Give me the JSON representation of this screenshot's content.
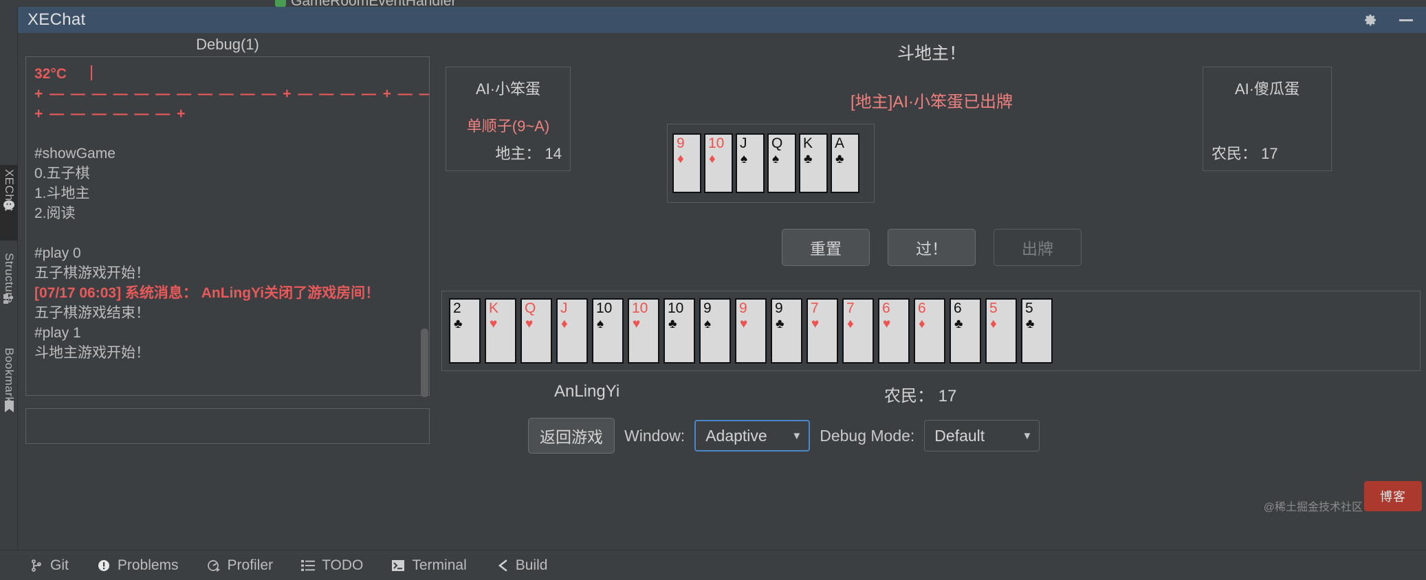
{
  "ide": {
    "ghost_tab": "GameRoomEventHandler",
    "left_tabs": [
      {
        "label": "XEChat",
        "icon": "chat-bubble-icon",
        "active": true
      },
      {
        "label": "Structure",
        "icon": "structure-icon",
        "active": false
      },
      {
        "label": "Bookmarks",
        "icon": "bookmark-icon",
        "active": false
      }
    ],
    "status_bar": [
      {
        "label": "Git",
        "icon": "git-branch-icon"
      },
      {
        "label": "Problems",
        "icon": "problems-icon"
      },
      {
        "label": "Profiler",
        "icon": "profiler-icon"
      },
      {
        "label": "TODO",
        "icon": "todo-list-icon"
      },
      {
        "label": "Terminal",
        "icon": "terminal-icon"
      },
      {
        "label": "Build",
        "icon": "build-hammer-icon"
      }
    ]
  },
  "window": {
    "title": "XEChat",
    "settings_icon": "gear-icon",
    "minimize_icon": "minimize-icon"
  },
  "debug": {
    "header": "Debug(1)",
    "lines": [
      {
        "text": "32°C",
        "style": "red",
        "cursor": true
      },
      {
        "text": "+ — — — — — — — — — — — + — — — — + — — — — —",
        "style": "redplain"
      },
      {
        "text": "+ — — — — — — +",
        "style": "redplain"
      },
      {
        "text": "",
        "style": "blank"
      },
      {
        "text": "#showGame",
        "style": "normal"
      },
      {
        "text": "0.五子棋",
        "style": "normal"
      },
      {
        "text": "1.斗地主",
        "style": "normal"
      },
      {
        "text": "2.阅读",
        "style": "normal"
      },
      {
        "text": "",
        "style": "blank"
      },
      {
        "text": "#play 0",
        "style": "normal"
      },
      {
        "text": "五子棋游戏开始！",
        "style": "normal"
      },
      {
        "text": "[07/17 06:03] 系统消息： AnLingYi关闭了游戏房间！",
        "style": "red"
      },
      {
        "text": "五子棋游戏结束！",
        "style": "normal"
      },
      {
        "text": "#play 1",
        "style": "normal"
      },
      {
        "text": "斗地主游戏开始！",
        "style": "normal"
      }
    ],
    "input_value": ""
  },
  "game": {
    "title": "斗地主！",
    "status_message": "[地主]AI·小笨蛋已出牌",
    "ai_left": {
      "name": "AI·小笨蛋",
      "move": "单顺子(9~A)",
      "role_count": "地主： 14"
    },
    "ai_right": {
      "name": "AI·傻瓜蛋",
      "move": "",
      "role_count": "农民： 17"
    },
    "played_cards": [
      {
        "rank": "9",
        "suit": "♦",
        "color": "red"
      },
      {
        "rank": "10",
        "suit": "♦",
        "color": "red"
      },
      {
        "rank": "J",
        "suit": "♠",
        "color": "black"
      },
      {
        "rank": "Q",
        "suit": "♠",
        "color": "black"
      },
      {
        "rank": "K",
        "suit": "♣",
        "color": "black"
      },
      {
        "rank": "A",
        "suit": "♣",
        "color": "black"
      }
    ],
    "actions": [
      {
        "label": "重置",
        "enabled": true
      },
      {
        "label": "过！",
        "enabled": true
      },
      {
        "label": "出牌",
        "enabled": false
      }
    ],
    "hand_cards": [
      {
        "rank": "2",
        "suit": "♣",
        "color": "black"
      },
      {
        "rank": "K",
        "suit": "♥",
        "color": "red"
      },
      {
        "rank": "Q",
        "suit": "♥",
        "color": "red"
      },
      {
        "rank": "J",
        "suit": "♦",
        "color": "red"
      },
      {
        "rank": "10",
        "suit": "♠",
        "color": "black"
      },
      {
        "rank": "10",
        "suit": "♥",
        "color": "red"
      },
      {
        "rank": "10",
        "suit": "♣",
        "color": "black"
      },
      {
        "rank": "9",
        "suit": "♠",
        "color": "black"
      },
      {
        "rank": "9",
        "suit": "♥",
        "color": "red"
      },
      {
        "rank": "9",
        "suit": "♣",
        "color": "black"
      },
      {
        "rank": "7",
        "suit": "♥",
        "color": "red"
      },
      {
        "rank": "7",
        "suit": "♦",
        "color": "red"
      },
      {
        "rank": "6",
        "suit": "♥",
        "color": "red"
      },
      {
        "rank": "6",
        "suit": "♦",
        "color": "red"
      },
      {
        "rank": "6",
        "suit": "♣",
        "color": "black"
      },
      {
        "rank": "5",
        "suit": "♦",
        "color": "red"
      },
      {
        "rank": "5",
        "suit": "♣",
        "color": "black"
      }
    ],
    "player_name": "AnLingYi",
    "player_count": "农民： 17",
    "controls": {
      "back_button": "返回游戏",
      "window_label": "Window:",
      "window_value": "Adaptive",
      "debug_mode_label": "Debug Mode:",
      "debug_mode_value": "Default"
    }
  },
  "watermark": {
    "badge": "博客",
    "credit": "@稀土掘金技术社区"
  },
  "colors": {
    "accent_red": "#e8595a",
    "card_red": "#ef5350",
    "titlebar": "#3c5167",
    "focus_blue": "#4a88c7"
  }
}
